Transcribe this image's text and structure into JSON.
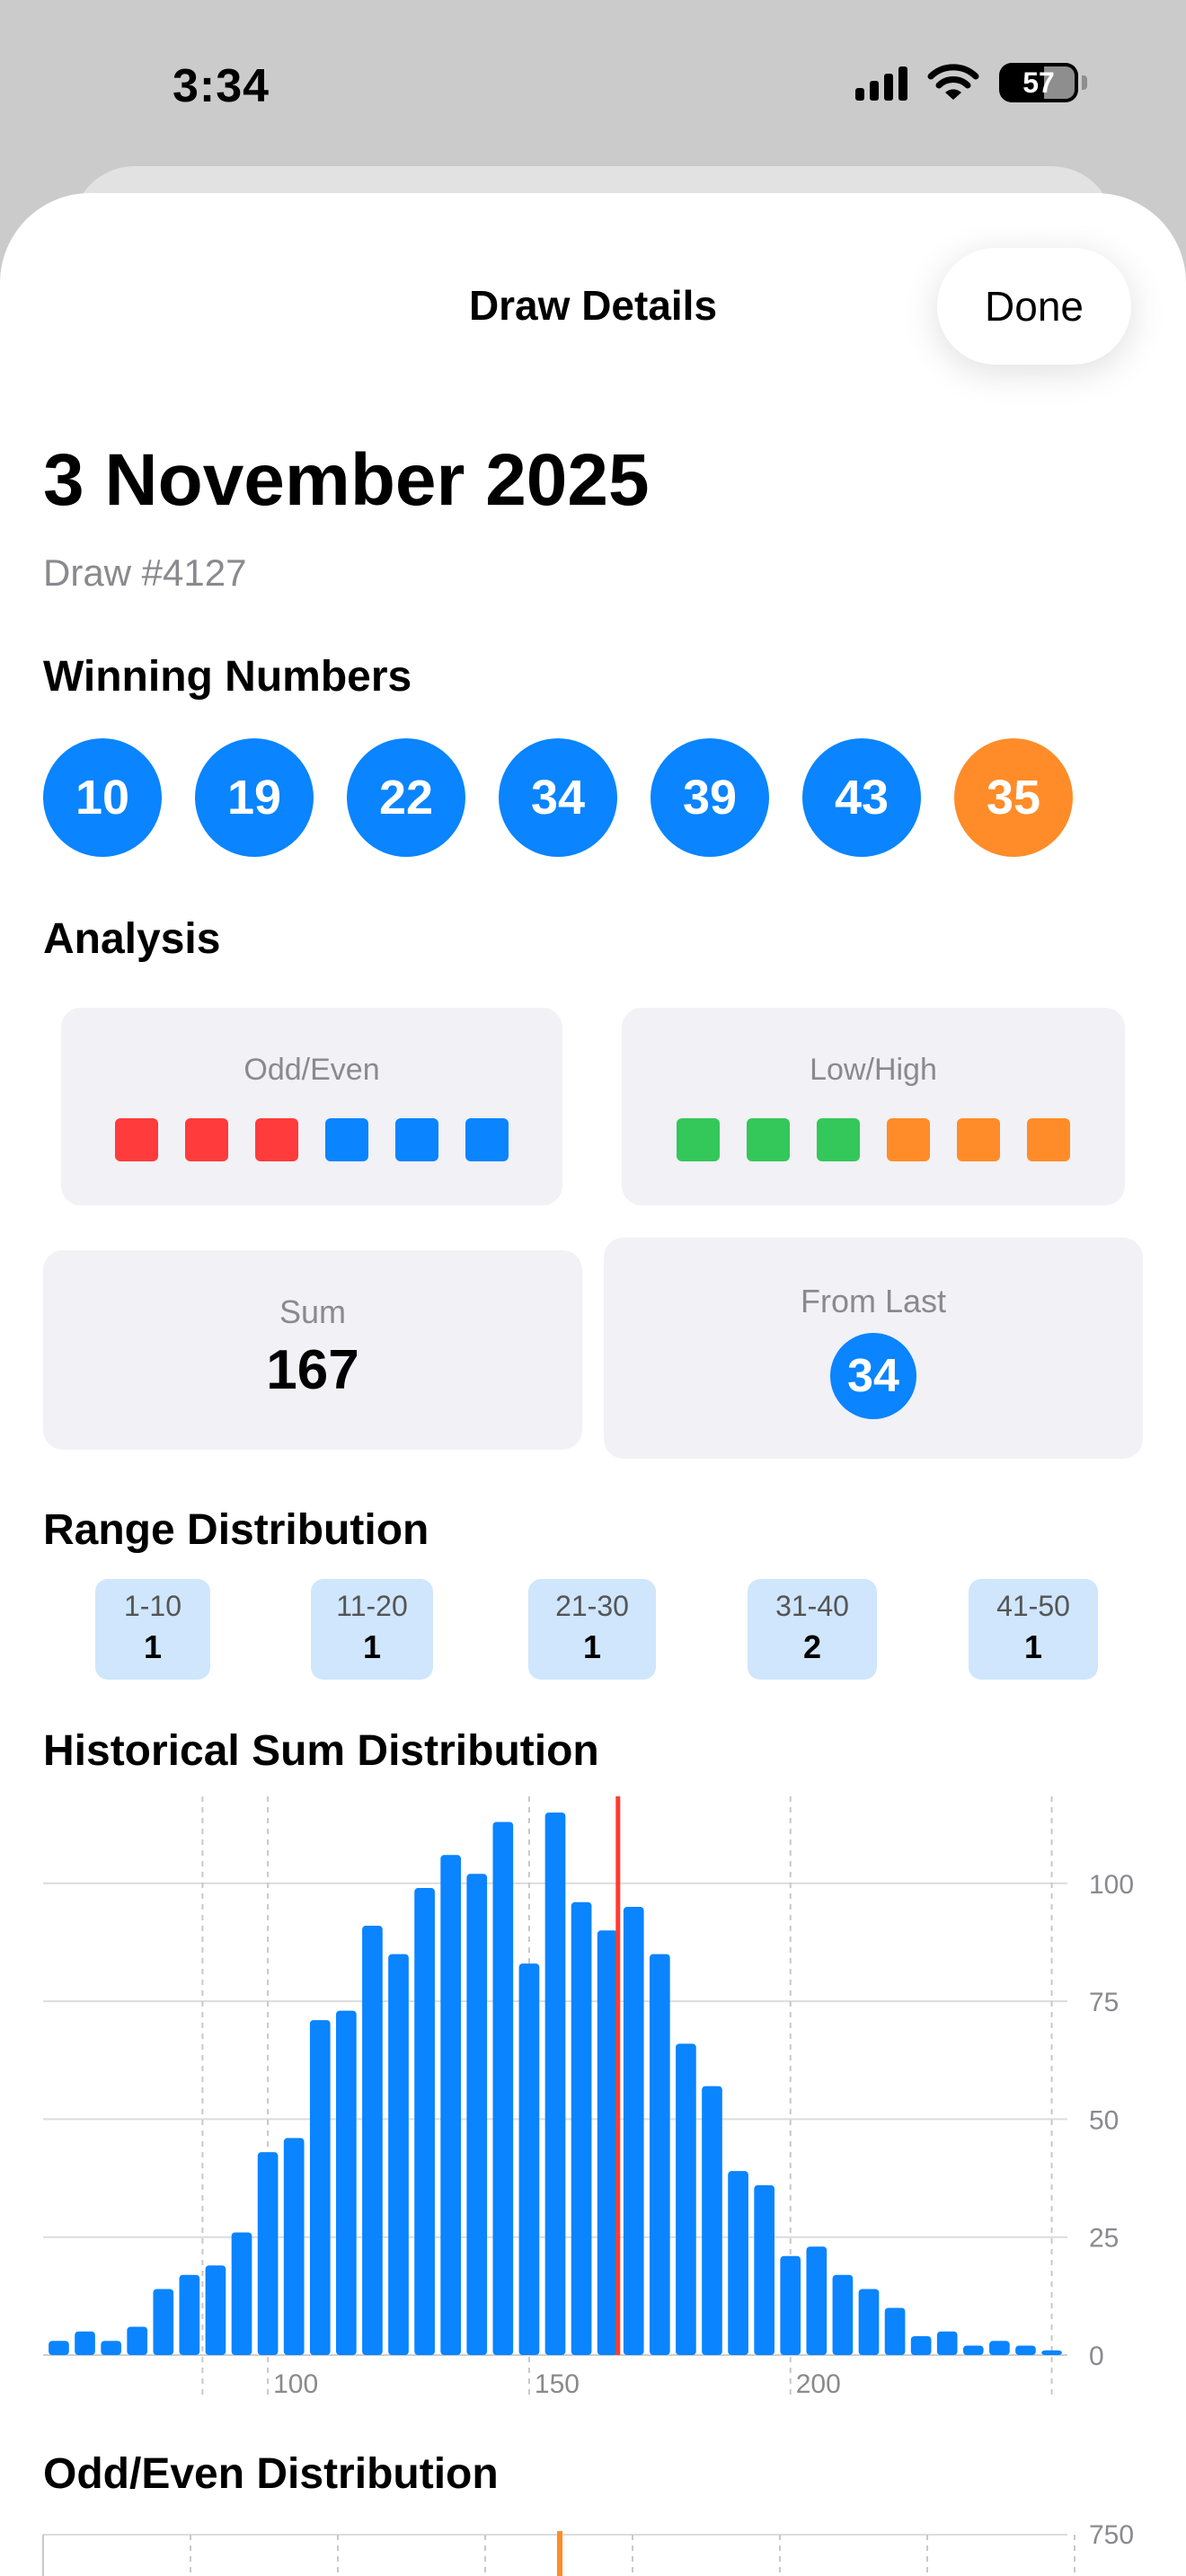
{
  "status": {
    "time": "3:34",
    "battery": "57"
  },
  "header": {
    "title": "Draw Details",
    "done_label": "Done"
  },
  "draw": {
    "date": "3 November 2025",
    "number": "Draw #4127"
  },
  "winning": {
    "title": "Winning Numbers",
    "numbers": [
      "10",
      "19",
      "22",
      "34",
      "39",
      "43"
    ],
    "bonus": "35"
  },
  "analysis": {
    "title": "Analysis",
    "odd_even": {
      "label": "Odd/Even",
      "colors": [
        "#ff3b3b",
        "#ff3b3b",
        "#ff3b3b",
        "#0a84ff",
        "#0a84ff",
        "#0a84ff"
      ]
    },
    "low_high": {
      "label": "Low/High",
      "colors": [
        "#34c759",
        "#34c759",
        "#34c759",
        "#ff8c28",
        "#ff8c28",
        "#ff8c28"
      ]
    },
    "sum": {
      "label": "Sum",
      "value": "167"
    },
    "from_last": {
      "label": "From Last",
      "value": "34"
    }
  },
  "range_distribution": {
    "title": "Range Distribution",
    "ranges": [
      {
        "label": "1-10",
        "count": "1"
      },
      {
        "label": "11-20",
        "count": "1"
      },
      {
        "label": "21-30",
        "count": "1"
      },
      {
        "label": "31-40",
        "count": "2"
      },
      {
        "label": "41-50",
        "count": "1"
      }
    ]
  },
  "colors": {
    "accent": "#0a84ff",
    "bonus": "#ff8c28",
    "marker": "#ff3b30",
    "odd": "#ff3b3b",
    "low": "#34c759"
  },
  "chart_data": [
    {
      "type": "bar",
      "title": "Historical Sum Distribution",
      "x": [
        60,
        65,
        70,
        75,
        80,
        85,
        90,
        95,
        100,
        105,
        110,
        115,
        120,
        125,
        130,
        135,
        140,
        145,
        150,
        155,
        160,
        165,
        170,
        175,
        180,
        185,
        190,
        195,
        200,
        205,
        210,
        215,
        220,
        225,
        230,
        235,
        240,
        245,
        250
      ],
      "values": [
        3,
        5,
        3,
        6,
        14,
        17,
        19,
        26,
        43,
        46,
        71,
        73,
        91,
        85,
        99,
        106,
        102,
        113,
        83,
        115,
        96,
        90,
        95,
        85,
        66,
        57,
        39,
        36,
        21,
        23,
        17,
        14,
        10,
        4,
        5,
        2,
        3,
        2,
        1
      ],
      "xticks": [
        100,
        150,
        200
      ],
      "yticks": [
        0,
        25,
        50,
        75,
        100
      ],
      "xlim": [
        57,
        253
      ],
      "ylim": [
        0,
        115
      ],
      "marker": 167,
      "grid": true,
      "y_axis_side": "right"
    },
    {
      "type": "bar",
      "title": "Odd/Even Distribution",
      "yticks": [
        750
      ],
      "ylim": [
        0,
        750
      ]
    }
  ]
}
